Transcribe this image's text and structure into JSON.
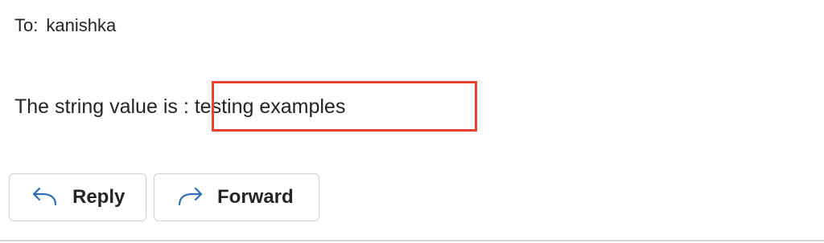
{
  "email": {
    "to_label": "To:",
    "to_name": "kanishka",
    "body_prefix": "The string value is : ",
    "body_value": "testing examples"
  },
  "actions": {
    "reply_label": "Reply",
    "forward_label": "Forward"
  },
  "icons": {
    "reply": "reply-arrow-icon",
    "forward": "forward-arrow-icon"
  },
  "colors": {
    "highlight_border": "#e8432f",
    "icon": "#2f6db5"
  }
}
